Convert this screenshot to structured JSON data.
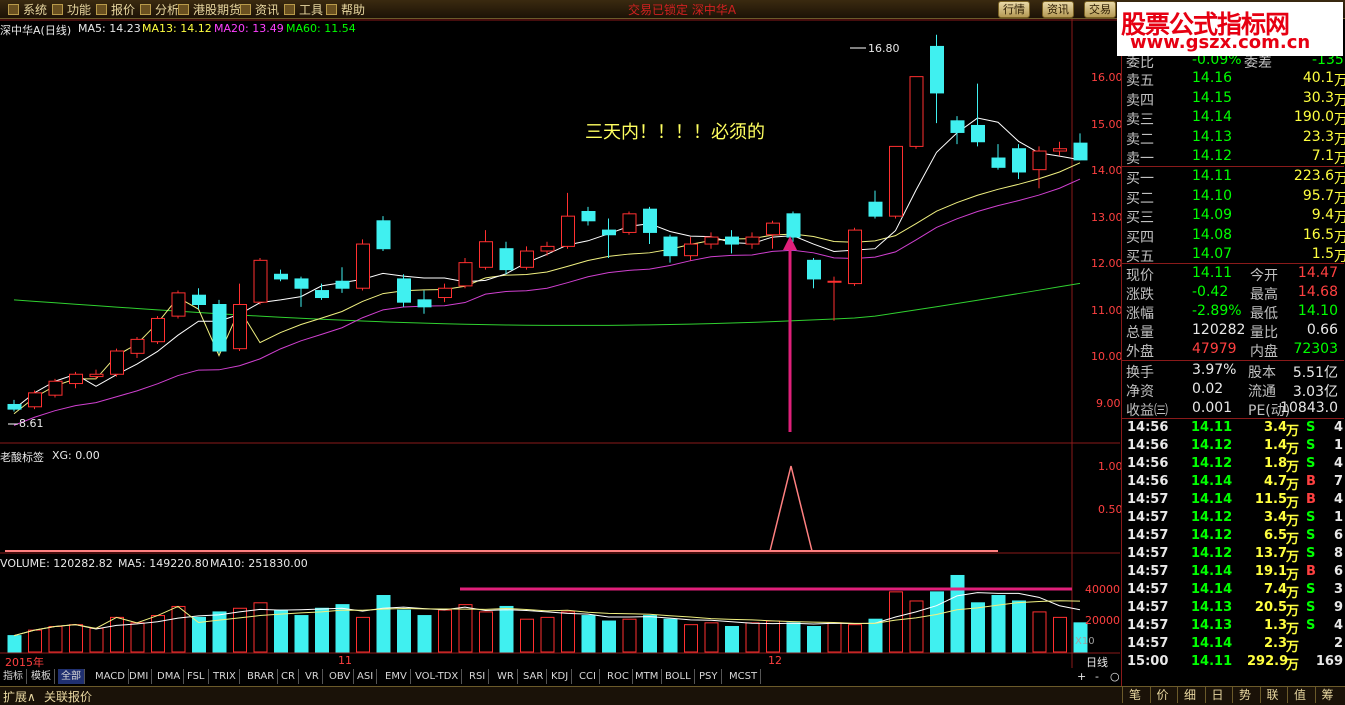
{
  "menu": [
    "系统",
    "功能",
    "报价",
    "分析",
    "港股期货",
    "资讯",
    "工具",
    "帮助"
  ],
  "center_title": "交易已锁定   深中华A",
  "top_buttons": [
    "行情",
    "资讯",
    "交易"
  ],
  "watermark": {
    "line1": "股票公式指标网",
    "line2": "www.gszx.com.cn"
  },
  "main_chart": {
    "stock": "深中华A(日线)",
    "ma5": "MA5: 14.23",
    "ma13": "MA13: 14.12",
    "ma20": "MA20: 13.49",
    "ma60": "MA60: 11.54",
    "annotation": "三天内！！！！必须的",
    "high_label": "16.80",
    "low_label": "8.61",
    "y_ticks": [
      "16.00",
      "15.00",
      "14.00",
      "13.00",
      "12.00",
      "11.00",
      "10.00",
      "9.00"
    ]
  },
  "indicator": {
    "title": "老酸标签",
    "value": "XG: 0.00",
    "y_ticks": [
      "1.00",
      "0.50"
    ]
  },
  "volume": {
    "label": "VOLUME: 120282.82",
    "ma5": "MA5: 149220.80",
    "ma10": "MA10: 251830.00",
    "y_ticks": [
      "40000",
      "20000"
    ],
    "unit": "X10"
  },
  "date_axis": {
    "d1": "2015年",
    "d2": "11",
    "d3": "12",
    "period": "日线"
  },
  "indicator_tabs": [
    "指标",
    "模板",
    "全部",
    "MACD",
    "DMI",
    "DMA",
    "FSL",
    "TRIX",
    "BRAR",
    "CR",
    "VR",
    "OBV",
    "ASI",
    "EMV",
    "VOL-TDX",
    "RSI",
    "WR",
    "SAR",
    "KDJ",
    "CCI",
    "ROC",
    "MTM",
    "BOLL",
    "PSY",
    "MCST"
  ],
  "bottom_left": [
    "扩展∧",
    "关联报价"
  ],
  "bottom_right": [
    "笔",
    "价",
    "细",
    "日",
    "势",
    "联",
    "值",
    "筹"
  ],
  "order_book": {
    "wb_label": "委比",
    "wb_value": "-0.09%",
    "wc_label": "委差",
    "wc_value": "-135",
    "sell": [
      {
        "label": "卖五",
        "price": "14.16",
        "vol": "40.1",
        "unit": "万"
      },
      {
        "label": "卖四",
        "price": "14.15",
        "vol": "30.3",
        "unit": "万"
      },
      {
        "label": "卖三",
        "price": "14.14",
        "vol": "190.0",
        "unit": "万"
      },
      {
        "label": "卖二",
        "price": "14.13",
        "vol": "23.3",
        "unit": "万"
      },
      {
        "label": "卖一",
        "price": "14.12",
        "vol": "7.1",
        "unit": "万"
      }
    ],
    "buy": [
      {
        "label": "买一",
        "price": "14.11",
        "vol": "223.6",
        "unit": "万"
      },
      {
        "label": "买二",
        "price": "14.10",
        "vol": "95.7",
        "unit": "万"
      },
      {
        "label": "买三",
        "price": "14.09",
        "vol": "9.4",
        "unit": "万"
      },
      {
        "label": "买四",
        "price": "14.08",
        "vol": "16.5",
        "unit": "万"
      },
      {
        "label": "买五",
        "price": "14.07",
        "vol": "1.5",
        "unit": "万"
      }
    ]
  },
  "quote": [
    {
      "l": "现价",
      "v": "14.11",
      "l2": "今开",
      "v2": "14.47",
      "c1": "green",
      "c2": "red"
    },
    {
      "l": "涨跌",
      "v": "-0.42",
      "l2": "最高",
      "v2": "14.68",
      "c1": "green",
      "c2": "red"
    },
    {
      "l": "涨幅",
      "v": "-2.89%",
      "l2": "最低",
      "v2": "14.10",
      "c1": "green",
      "c2": "green"
    },
    {
      "l": "总量",
      "v": "120282",
      "l2": "量比",
      "v2": "0.66",
      "c1": "white",
      "c2": "white"
    },
    {
      "l": "外盘",
      "v": "47979",
      "l2": "内盘",
      "v2": "72303",
      "c1": "red",
      "c2": "green"
    }
  ],
  "quote2": [
    {
      "l": "换手",
      "v": "3.97%",
      "l2": "股本",
      "v2": "5.51亿"
    },
    {
      "l": "净资",
      "v": "0.02",
      "l2": "流通",
      "v2": "3.03亿"
    },
    {
      "l": "收益㈢",
      "v": "0.001",
      "l2": "PE(动)",
      "v2": "10843.0"
    }
  ],
  "ticks": [
    {
      "t": "14:56",
      "p": "14.11",
      "v": "3.4",
      "u": "万",
      "s": "S",
      "n": "4"
    },
    {
      "t": "14:56",
      "p": "14.12",
      "v": "1.4",
      "u": "万",
      "s": "S",
      "n": "1"
    },
    {
      "t": "14:56",
      "p": "14.12",
      "v": "1.8",
      "u": "万",
      "s": "S",
      "n": "4"
    },
    {
      "t": "14:56",
      "p": "14.14",
      "v": "4.7",
      "u": "万",
      "s": "B",
      "n": "7"
    },
    {
      "t": "14:57",
      "p": "14.14",
      "v": "11.5",
      "u": "万",
      "s": "B",
      "n": "4"
    },
    {
      "t": "14:57",
      "p": "14.12",
      "v": "3.4",
      "u": "万",
      "s": "S",
      "n": "1"
    },
    {
      "t": "14:57",
      "p": "14.12",
      "v": "6.5",
      "u": "万",
      "s": "S",
      "n": "6"
    },
    {
      "t": "14:57",
      "p": "14.12",
      "v": "13.7",
      "u": "万",
      "s": "S",
      "n": "8"
    },
    {
      "t": "14:57",
      "p": "14.14",
      "v": "19.1",
      "u": "万",
      "s": "B",
      "n": "6"
    },
    {
      "t": "14:57",
      "p": "14.14",
      "v": "7.4",
      "u": "万",
      "s": "S",
      "n": "3"
    },
    {
      "t": "14:57",
      "p": "14.13",
      "v": "20.5",
      "u": "万",
      "s": "S",
      "n": "9"
    },
    {
      "t": "14:57",
      "p": "14.13",
      "v": "1.3",
      "u": "万",
      "s": "S",
      "n": "4"
    },
    {
      "t": "14:57",
      "p": "14.14",
      "v": "2.3",
      "u": "万",
      "s": "",
      "n": "2"
    },
    {
      "t": "15:00",
      "p": "14.11",
      "v": "292.9",
      "u": "万",
      "s": "",
      "n": "169"
    }
  ],
  "chart_data": {
    "type": "candlestick",
    "y_range": [
      8.4,
      17.0
    ],
    "candles": [
      [
        8.85,
        8.75,
        8.95,
        8.7
      ],
      [
        8.8,
        9.1,
        9.15,
        8.75
      ],
      [
        9.05,
        9.35,
        9.4,
        9.0
      ],
      [
        9.3,
        9.5,
        9.55,
        9.2
      ],
      [
        9.45,
        9.5,
        9.6,
        9.4
      ],
      [
        9.5,
        10.0,
        10.05,
        9.45
      ],
      [
        9.95,
        10.25,
        10.3,
        9.85
      ],
      [
        10.2,
        10.7,
        10.75,
        10.15
      ],
      [
        10.75,
        11.25,
        11.3,
        10.7
      ],
      [
        11.2,
        11.0,
        11.35,
        10.9
      ],
      [
        11.0,
        10.0,
        11.1,
        9.95
      ],
      [
        10.05,
        11.0,
        11.45,
        10.0
      ],
      [
        11.05,
        11.95,
        12.0,
        11.0
      ],
      [
        11.65,
        11.55,
        11.75,
        11.5
      ],
      [
        11.55,
        11.35,
        11.6,
        10.95
      ],
      [
        11.3,
        11.15,
        11.45,
        11.1
      ],
      [
        11.5,
        11.35,
        11.8,
        11.25
      ],
      [
        11.35,
        12.3,
        12.4,
        11.3
      ],
      [
        12.8,
        12.2,
        12.9,
        12.15
      ],
      [
        11.55,
        11.05,
        11.65,
        10.95
      ],
      [
        11.1,
        10.95,
        11.3,
        10.8
      ],
      [
        11.15,
        11.35,
        11.45,
        11.05
      ],
      [
        11.4,
        11.9,
        12.0,
        11.35
      ],
      [
        11.8,
        12.35,
        12.6,
        11.75
      ],
      [
        12.2,
        11.75,
        12.35,
        11.65
      ],
      [
        11.8,
        12.15,
        12.25,
        11.75
      ],
      [
        12.15,
        12.25,
        12.35,
        12.05
      ],
      [
        12.25,
        12.9,
        13.4,
        12.2
      ],
      [
        13.0,
        12.8,
        13.1,
        12.7
      ],
      [
        12.6,
        12.5,
        12.85,
        12.0
      ],
      [
        12.55,
        12.95,
        13.0,
        12.5
      ],
      [
        13.05,
        12.55,
        13.1,
        12.3
      ],
      [
        12.45,
        12.05,
        12.5,
        11.9
      ],
      [
        12.05,
        12.3,
        12.45,
        11.95
      ],
      [
        12.3,
        12.45,
        12.55,
        12.2
      ],
      [
        12.45,
        12.3,
        12.6,
        12.1
      ],
      [
        12.3,
        12.45,
        12.55,
        12.2
      ],
      [
        12.5,
        12.75,
        12.8,
        12.2
      ],
      [
        12.95,
        12.45,
        13.0,
        12.35
      ],
      [
        11.95,
        11.55,
        12.0,
        11.35
      ],
      [
        11.5,
        11.5,
        11.6,
        10.65
      ],
      [
        11.45,
        12.6,
        12.65,
        11.4
      ],
      [
        13.2,
        12.9,
        13.45,
        12.85
      ],
      [
        12.9,
        14.4,
        14.4,
        12.85
      ],
      [
        14.4,
        15.9,
        15.9,
        14.35
      ],
      [
        16.55,
        15.55,
        16.8,
        14.9
      ],
      [
        14.95,
        14.7,
        15.05,
        14.45
      ],
      [
        14.85,
        14.5,
        15.75,
        14.4
      ],
      [
        14.15,
        13.95,
        14.45,
        13.9
      ],
      [
        14.35,
        13.85,
        14.45,
        13.7
      ],
      [
        13.9,
        14.3,
        14.4,
        13.5
      ],
      [
        14.3,
        14.35,
        14.5,
        14.2
      ],
      [
        14.47,
        14.11,
        14.68,
        14.1
      ]
    ],
    "volume": [
      9,
      12,
      14,
      15,
      13,
      19,
      16,
      20,
      25,
      19,
      22,
      24,
      27,
      23,
      20,
      24,
      26,
      19,
      31,
      23,
      20,
      23,
      26,
      22,
      25,
      18,
      19,
      22,
      20,
      17,
      18,
      20,
      18,
      15,
      16,
      14,
      16,
      17,
      16,
      14,
      16,
      15,
      18,
      33,
      28,
      33,
      42,
      27,
      31,
      28,
      22,
      19,
      16
    ]
  }
}
